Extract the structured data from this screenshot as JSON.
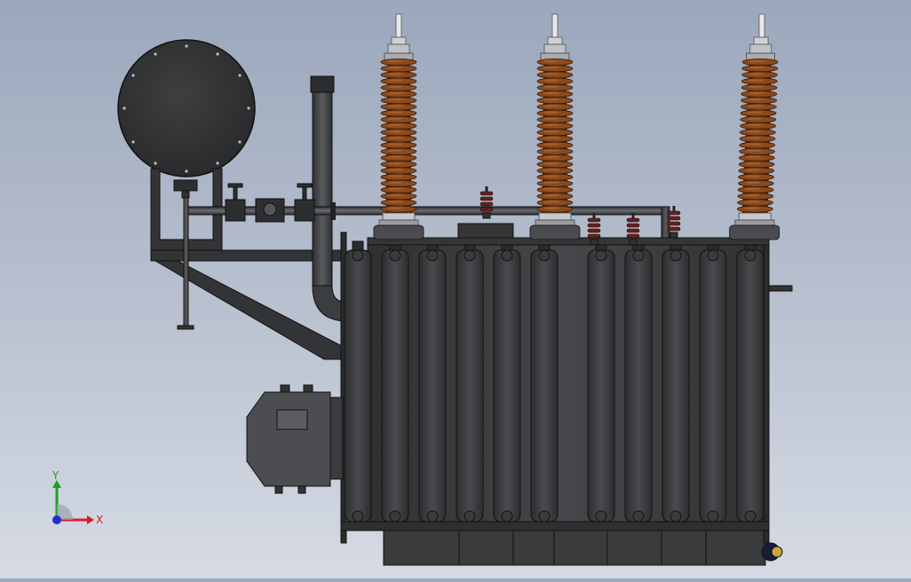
{
  "viewport": {
    "background_top": "#9ba7bc",
    "background_bottom": "#d6dbe4"
  },
  "model": {
    "body_color": "#3b3c3e",
    "dark_color": "#2a2b2c",
    "edge_color": "#101010",
    "insulator_color": "#8a4a1e",
    "insulator_highlight": "#a8622a",
    "small_bushing_color": "#6b1f1c",
    "cabinet_color": "#4a4c50"
  },
  "triad": {
    "x_label": "X",
    "y_label": "Y",
    "x_color": "#d42020",
    "y_color": "#1ea01e",
    "z_color": "#2030c8"
  }
}
